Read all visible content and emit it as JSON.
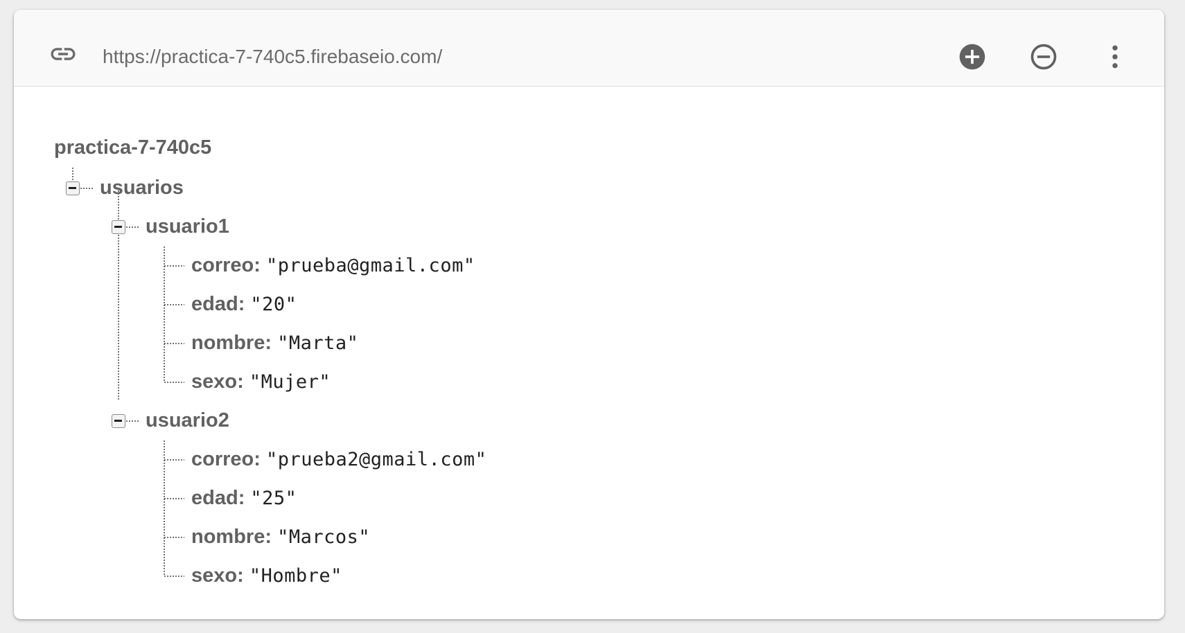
{
  "toolbar": {
    "url": "https://practica-7-740c5.firebaseio.com/",
    "icons": [
      "link-icon",
      "add-circle-icon",
      "remove-circle-icon",
      "more-vert-icon"
    ]
  },
  "tree": {
    "root": "practica-7-740c5",
    "node_usuarios": "usuarios",
    "usuario1": {
      "name": "usuario1",
      "fields": [
        {
          "key": "correo",
          "value": "\"prueba@gmail.com\""
        },
        {
          "key": "edad",
          "value": "\"20\""
        },
        {
          "key": "nombre",
          "value": "\"Marta\""
        },
        {
          "key": "sexo",
          "value": "\"Mujer\""
        }
      ]
    },
    "usuario2": {
      "name": "usuario2",
      "fields": [
        {
          "key": "correo",
          "value": "\"prueba2@gmail.com\""
        },
        {
          "key": "edad",
          "value": "\"25\""
        },
        {
          "key": "nombre",
          "value": "\"Marcos\""
        },
        {
          "key": "sexo",
          "value": "\"Hombre\""
        }
      ]
    }
  },
  "colors": {
    "accent_icon": "#616161",
    "text_key": "#616161",
    "text_value": "#212121"
  }
}
